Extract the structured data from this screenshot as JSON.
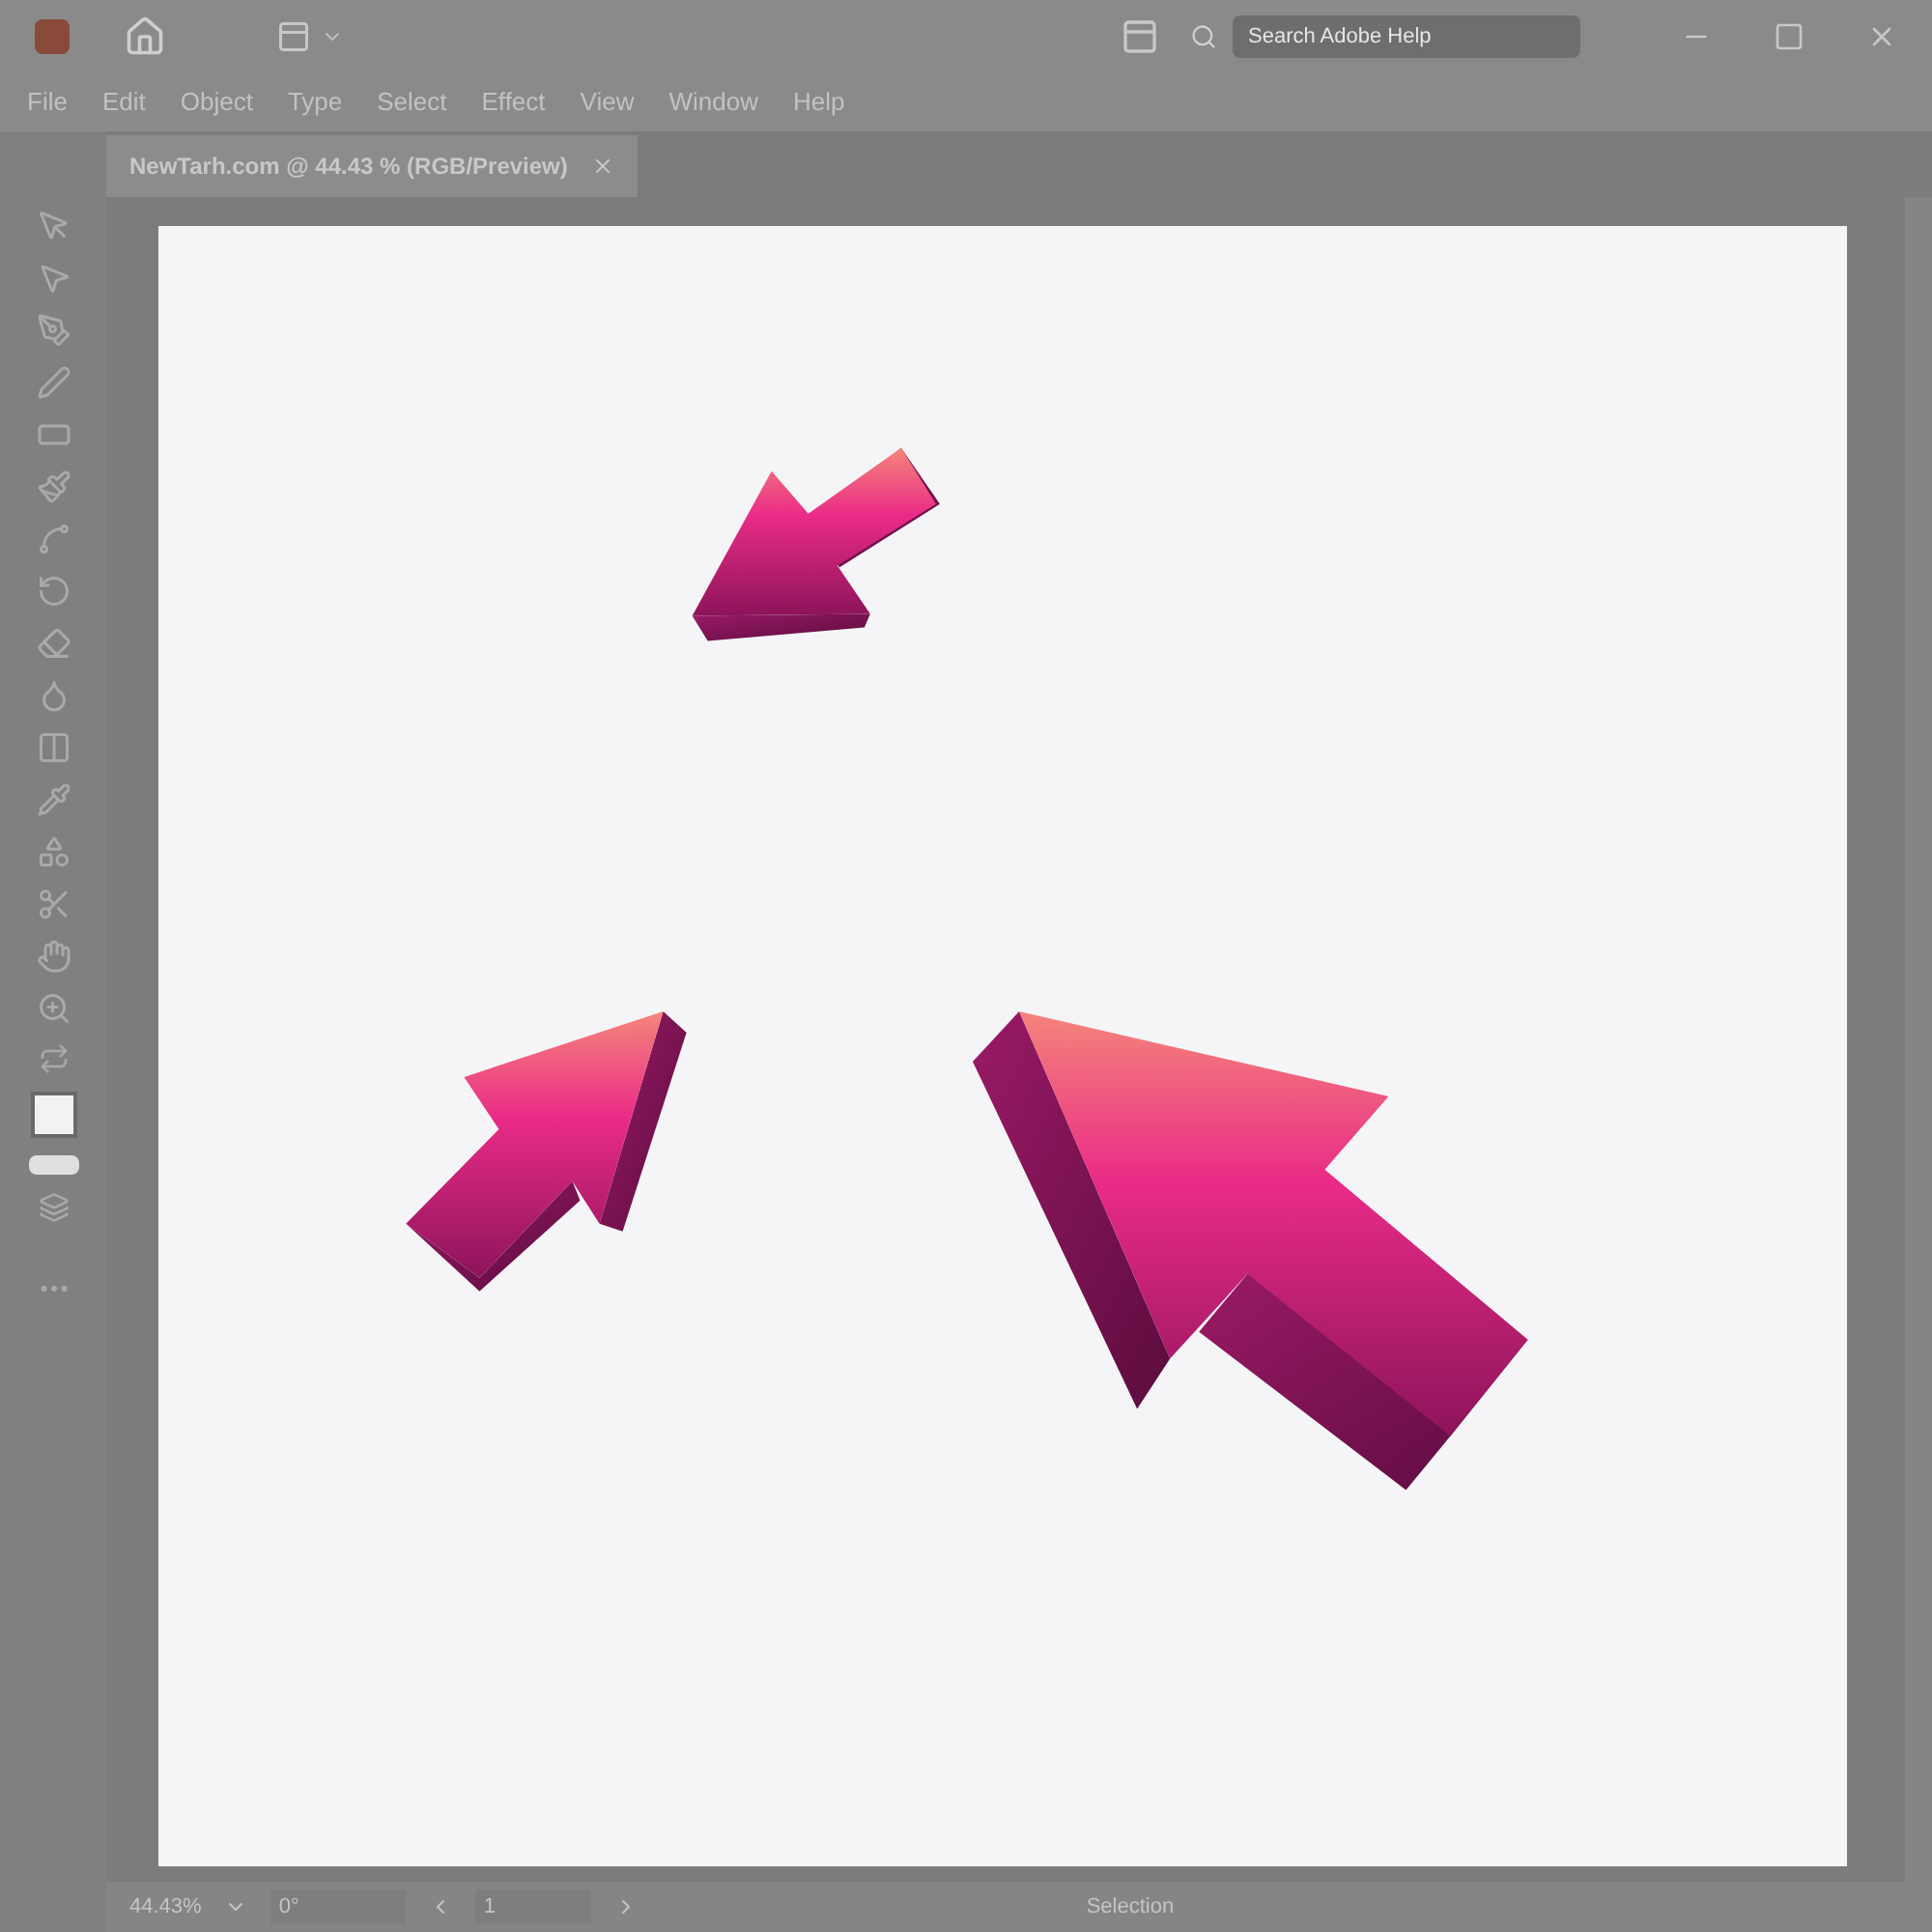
{
  "window": {
    "search": {
      "placeholder": "Search Adobe Help"
    }
  },
  "menu": [
    "File",
    "Edit",
    "Object",
    "Type",
    "Select",
    "Effect",
    "View",
    "Window",
    "Help"
  ],
  "document_tab": {
    "title": "NewTarh.com @ 44.43 % (RGB/Preview)"
  },
  "status_bar": {
    "zoom": "44.43%",
    "rotation": "0°",
    "artboard": "1",
    "tool": "Selection"
  }
}
